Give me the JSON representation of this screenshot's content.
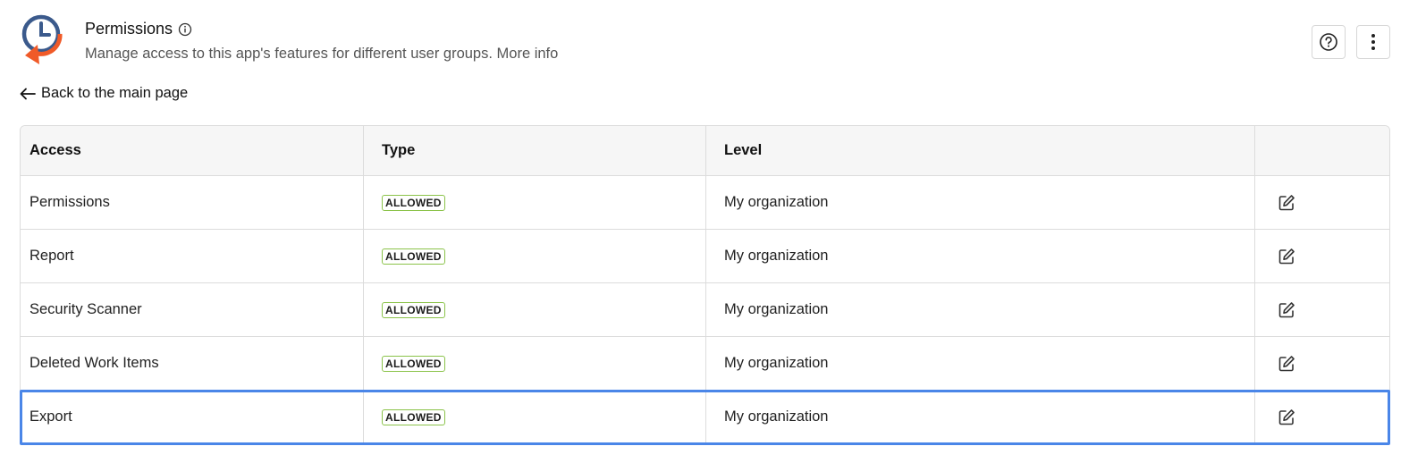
{
  "header": {
    "title": "Permissions",
    "subtitle": "Manage access to this app's features for different user groups.",
    "more_info_label": "More info",
    "icons": {
      "logo": "clock-arrow-logo",
      "info": "info-icon",
      "help": "help-circle-icon",
      "more": "more-vertical-icon"
    }
  },
  "nav": {
    "back_label": "Back to the main page",
    "back_icon": "arrow-left-icon"
  },
  "table": {
    "columns": [
      "Access",
      "Type",
      "Level",
      ""
    ],
    "rows": [
      {
        "access": "Permissions",
        "type": "ALLOWED",
        "level": "My organization"
      },
      {
        "access": "Report",
        "type": "ALLOWED",
        "level": "My organization"
      },
      {
        "access": "Security Scanner",
        "type": "ALLOWED",
        "level": "My organization"
      },
      {
        "access": "Deleted Work Items",
        "type": "ALLOWED",
        "level": "My organization"
      },
      {
        "access": "Export",
        "type": "ALLOWED",
        "level": "My organization"
      }
    ],
    "selected_row": "Export",
    "edit_icon": "edit-icon"
  },
  "colors": {
    "logo_blue": "#3b5a8c",
    "logo_orange": "#f05a28",
    "badge_border": "#8bc34a",
    "selection": "#4a86e8"
  }
}
